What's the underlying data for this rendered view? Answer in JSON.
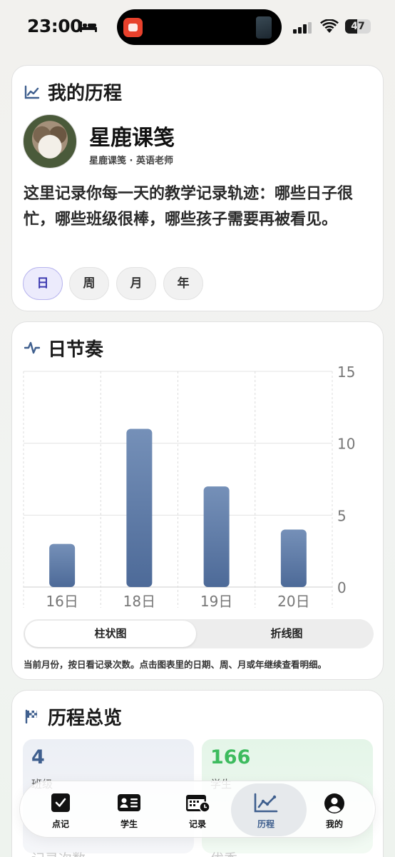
{
  "status_bar": {
    "time": "23:00",
    "battery": "47"
  },
  "journey": {
    "title": "我的历程",
    "profile_name": "星鹿课笺",
    "profile_subtitle": "星鹿课笺 · 英语老师",
    "intro": "这里记录你每一天的教学记录轨迹：哪些日子很忙，哪些班级很棒，哪些孩子需要再被看见。",
    "periods": [
      "日",
      "周",
      "月",
      "年"
    ],
    "active_period": "日"
  },
  "rhythm": {
    "title": "日节奏",
    "view_options": [
      "柱状图",
      "折线图"
    ],
    "active_view": "柱状图",
    "note": "当前月份，按日看记录次数。点击图表里的日期、周、月或年继续查看明细。"
  },
  "chart_data": {
    "type": "bar",
    "categories": [
      "16日",
      "18日",
      "19日",
      "20日"
    ],
    "values": [
      3,
      11,
      7,
      4
    ],
    "ylim": [
      0,
      15
    ],
    "yticks": [
      0,
      5,
      10,
      15
    ],
    "y_axis_side": "right",
    "grid": true,
    "bar_color": "#5a7aaa",
    "title": "",
    "xlabel": "",
    "ylabel": ""
  },
  "overview": {
    "title": "历程总览",
    "stats": [
      {
        "value": "4",
        "label": "班级",
        "color": "#3f5f8e"
      },
      {
        "value": "166",
        "label": "学生",
        "color": "#3dbb5e"
      }
    ],
    "partial_labels": [
      "记录次数",
      "优秀"
    ]
  },
  "tab_bar": {
    "items": [
      {
        "label": "点记",
        "icon": "check-square-icon"
      },
      {
        "label": "学生",
        "icon": "id-card-icon"
      },
      {
        "label": "记录",
        "icon": "calendar-clock-icon"
      },
      {
        "label": "历程",
        "icon": "line-chart-icon"
      },
      {
        "label": "我的",
        "icon": "user-circle-icon"
      }
    ],
    "active": "历程"
  }
}
